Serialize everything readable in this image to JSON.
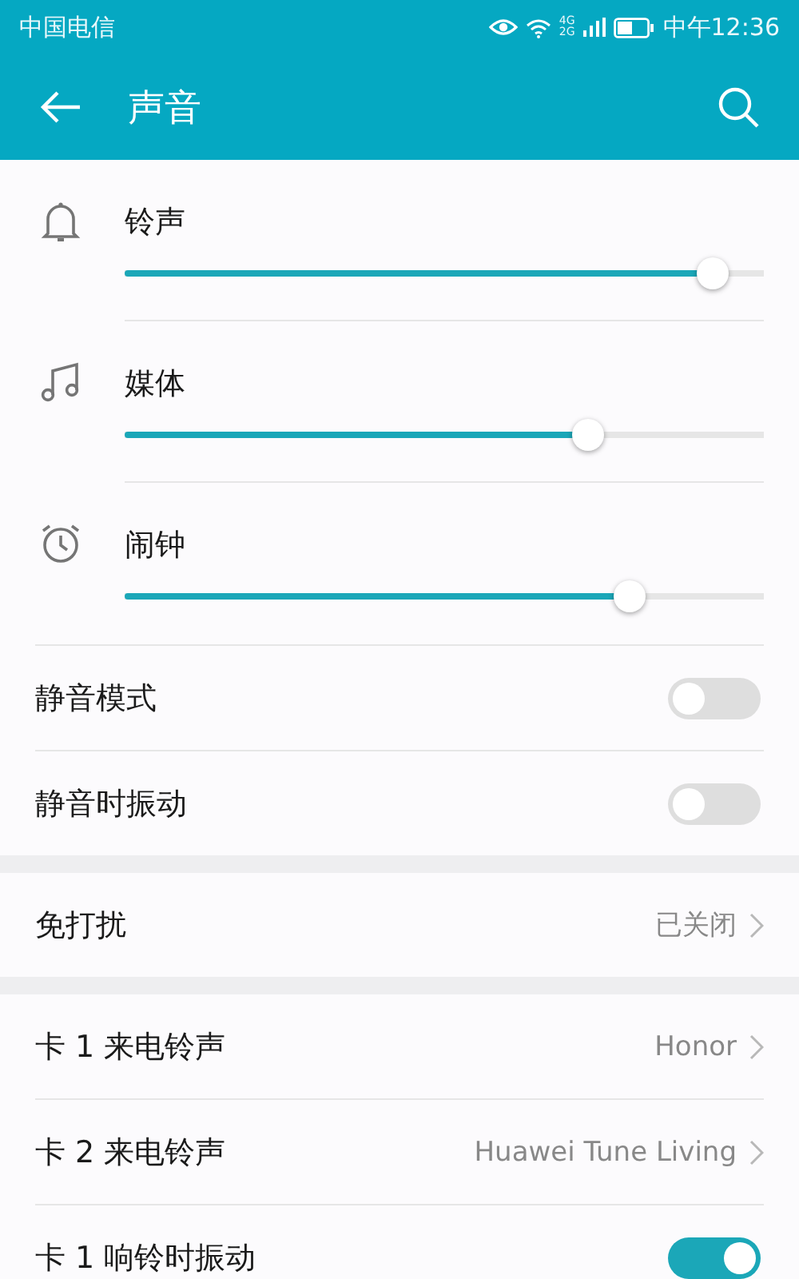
{
  "status_bar": {
    "carrier": "中国电信",
    "network_labels": [
      "4G",
      "2G"
    ],
    "time": "中午12:36"
  },
  "header": {
    "title": "声音"
  },
  "volumes": [
    {
      "kind": "bell",
      "label": "铃声",
      "level": 0.92
    },
    {
      "kind": "music",
      "label": "媒体",
      "level": 0.725
    },
    {
      "kind": "alarm",
      "label": "闹钟",
      "level": 0.79
    }
  ],
  "sections": [
    [
      {
        "kind": "toggle",
        "label": "静音模式",
        "on": false
      },
      {
        "kind": "toggle",
        "label": "静音时振动",
        "on": false
      }
    ],
    [
      {
        "kind": "link",
        "label": "免打扰",
        "value": "已关闭"
      }
    ],
    [
      {
        "kind": "link",
        "label": "卡 1 来电铃声",
        "value": "Honor"
      },
      {
        "kind": "link",
        "label": "卡 2 来电铃声",
        "value": "Huawei Tune Living"
      },
      {
        "kind": "toggle",
        "label": "卡 1 响铃时振动",
        "on": true
      }
    ]
  ]
}
